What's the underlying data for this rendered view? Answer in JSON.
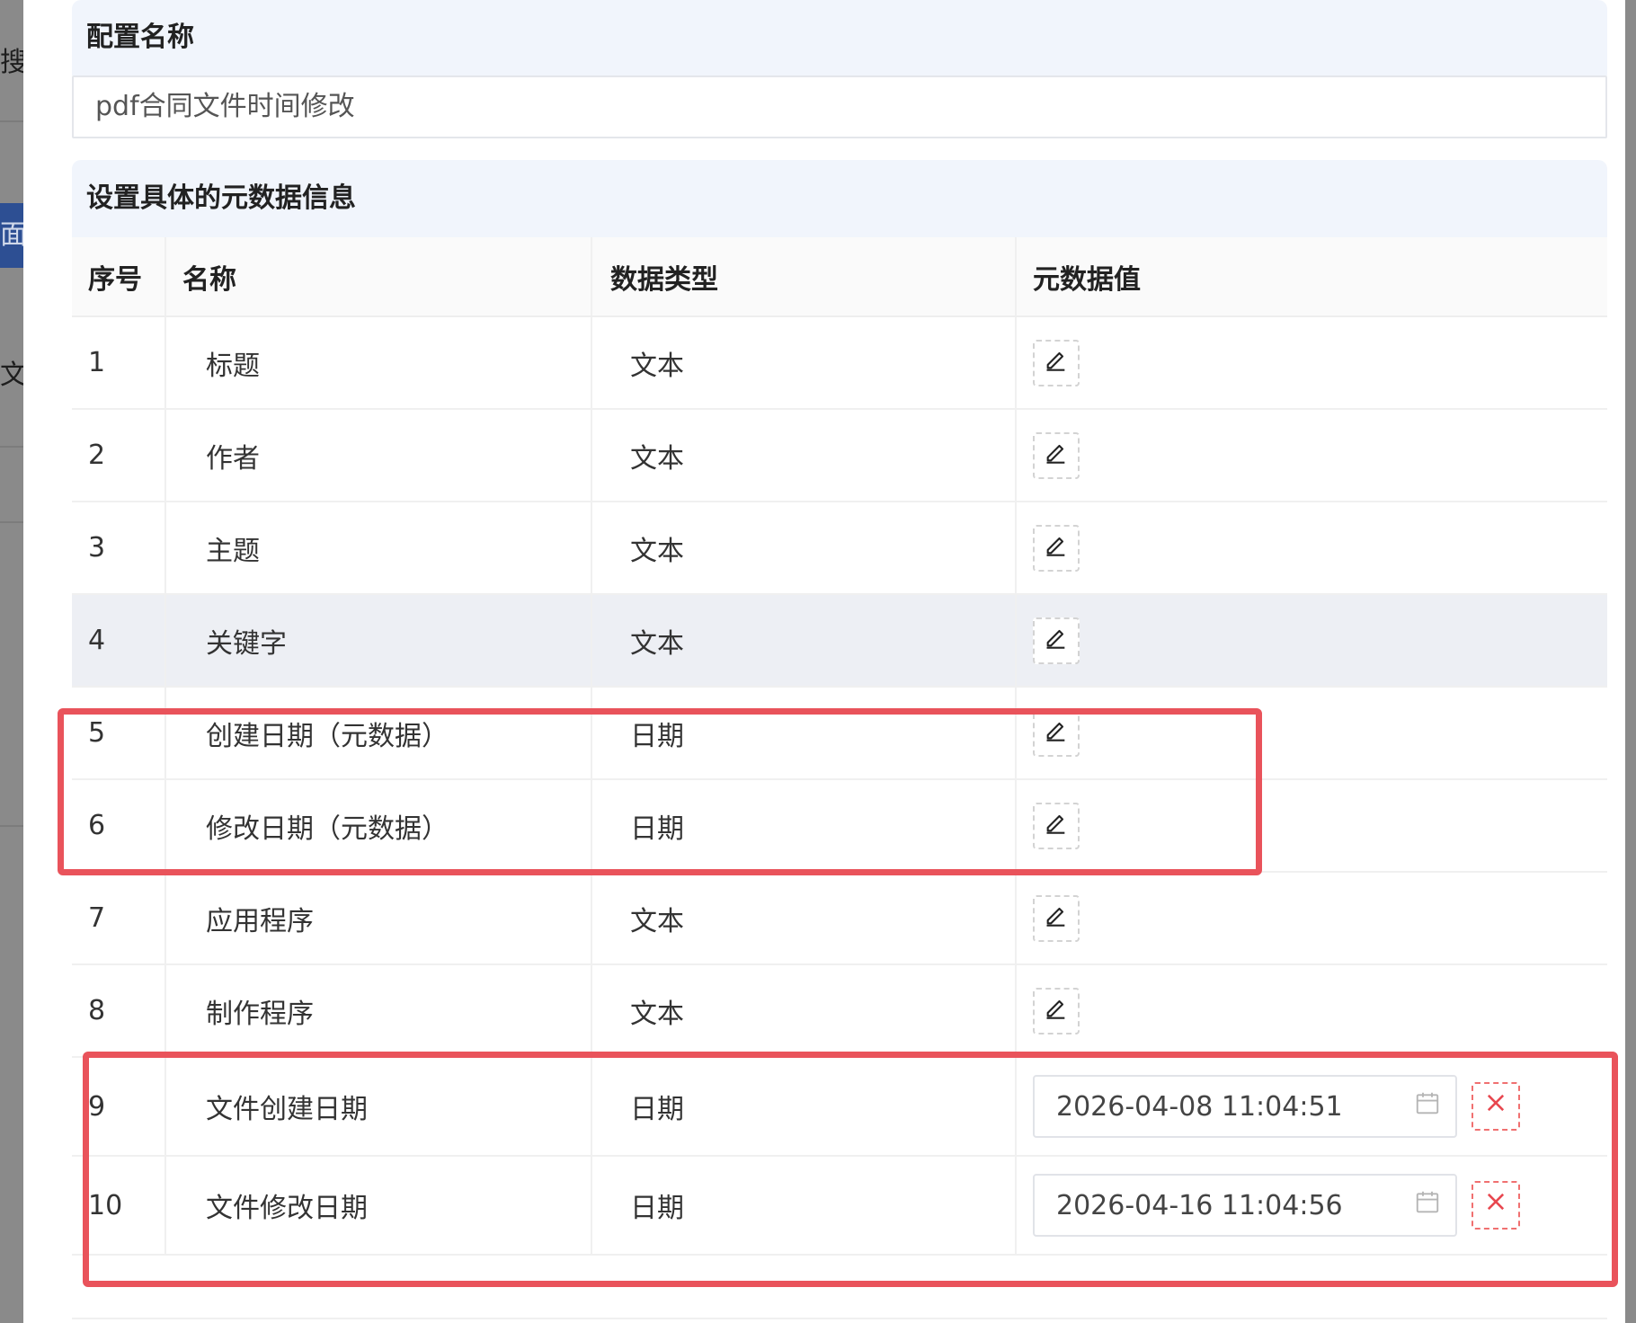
{
  "background": {
    "frag_1": "搜",
    "tab_fragment": "面板",
    "frag_2": "文"
  },
  "config": {
    "name_label": "配置名称",
    "name_value": "pdf合同文件时间修改"
  },
  "metadata": {
    "title": "设置具体的元数据信息",
    "columns": [
      "序号",
      "名称",
      "数据类型",
      "元数据值"
    ],
    "rows": [
      {
        "index": "1",
        "name": "标题",
        "type": "文本"
      },
      {
        "index": "2",
        "name": "作者",
        "type": "文本"
      },
      {
        "index": "3",
        "name": "主题",
        "type": "文本"
      },
      {
        "index": "4",
        "name": "关键字",
        "type": "文本"
      },
      {
        "index": "5",
        "name": "创建日期（元数据）",
        "type": "日期"
      },
      {
        "index": "6",
        "name": "修改日期（元数据）",
        "type": "日期"
      },
      {
        "index": "7",
        "name": "应用程序",
        "type": "文本"
      },
      {
        "index": "8",
        "name": "制作程序",
        "type": "文本"
      },
      {
        "index": "9",
        "name": "文件创建日期",
        "type": "日期",
        "value": "2026-04-08 11:04:51"
      },
      {
        "index": "10",
        "name": "文件修改日期",
        "type": "日期",
        "value": "2026-04-16 11:04:56"
      }
    ]
  },
  "icons": {
    "edit": "pencil-icon",
    "calendar": "calendar-icon",
    "delete": "close-icon"
  },
  "colors": {
    "highlight": "#e9535b",
    "header_bg": "#f1f5fc",
    "hover_row": "#edeff4",
    "delete": "#e8474f"
  }
}
